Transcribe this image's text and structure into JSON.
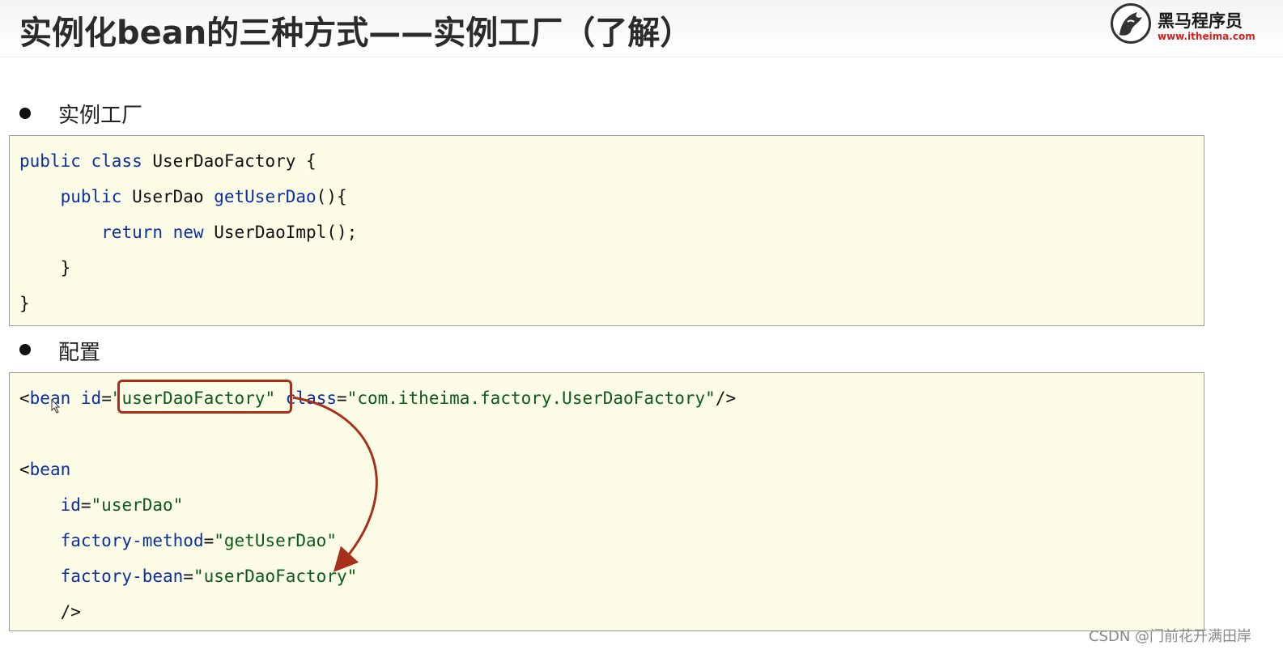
{
  "header": {
    "title": "实例化bean的三种方式——实例工厂（了解）",
    "logo_name": "黑马程序员",
    "logo_url": "www.itheima.com"
  },
  "sections": [
    {
      "label": "实例工厂",
      "code": [
        [
          [
            "kw",
            "public"
          ],
          [
            "p",
            " "
          ],
          [
            "kw",
            "class"
          ],
          [
            "p",
            " UserDaoFactory {"
          ]
        ],
        [
          [
            "p",
            "    "
          ],
          [
            "kw",
            "public"
          ],
          [
            "p",
            " UserDao "
          ],
          [
            "kw",
            "getUserDao"
          ],
          [
            "p",
            "(){"
          ]
        ],
        [
          [
            "p",
            "        "
          ],
          [
            "kw",
            "return"
          ],
          [
            "p",
            " "
          ],
          [
            "kw",
            "new"
          ],
          [
            "p",
            " UserDaoImpl();"
          ]
        ],
        [
          [
            "p",
            "    }"
          ]
        ],
        [
          [
            "p",
            "}"
          ]
        ]
      ]
    },
    {
      "label": "配置",
      "code": [
        [
          [
            "p",
            "<"
          ],
          [
            "kw",
            "bean"
          ],
          [
            "p",
            " "
          ],
          [
            "attr",
            "id"
          ],
          [
            "p",
            "="
          ],
          [
            "str",
            "\"userDaoFactory\""
          ],
          [
            "p",
            " "
          ],
          [
            "attr",
            "class"
          ],
          [
            "p",
            "="
          ],
          [
            "str",
            "\"com.itheima.factory.UserDaoFactory\""
          ],
          [
            "p",
            "/>"
          ]
        ],
        [
          [
            "p",
            ""
          ]
        ],
        [
          [
            "p",
            "<"
          ],
          [
            "kw",
            "bean"
          ]
        ],
        [
          [
            "p",
            "    "
          ],
          [
            "attr",
            "id"
          ],
          [
            "p",
            "="
          ],
          [
            "str",
            "\"userDao\""
          ]
        ],
        [
          [
            "p",
            "    "
          ],
          [
            "attr",
            "factory-method"
          ],
          [
            "p",
            "="
          ],
          [
            "str",
            "\"getUserDao\""
          ]
        ],
        [
          [
            "p",
            "    "
          ],
          [
            "attr",
            "factory-bean"
          ],
          [
            "p",
            "="
          ],
          [
            "str",
            "\"userDaoFactory\""
          ]
        ],
        [
          [
            "p",
            "    />"
          ]
        ]
      ]
    }
  ],
  "watermark": "CSDN @门前花开满田岸",
  "colors": {
    "keyword": "#0b2fa0",
    "string": "#0a5a1e",
    "highlight": "#a8301a",
    "code_bg": "#fdfce6"
  },
  "icons": [
    "logo-horse-icon",
    "mouse-cursor-icon",
    "highlight-arrow-icon"
  ]
}
